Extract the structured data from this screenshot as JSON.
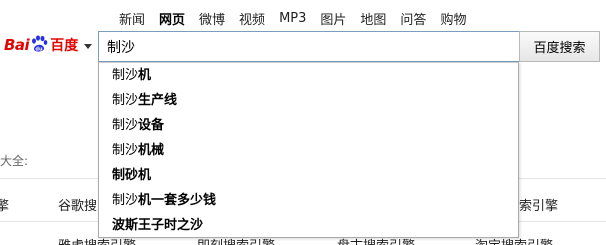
{
  "nav": {
    "items": [
      {
        "label": "新闻",
        "active": false
      },
      {
        "label": "网页",
        "active": true
      },
      {
        "label": "微博",
        "active": false
      },
      {
        "label": "视频",
        "active": false
      },
      {
        "label": "MP3",
        "active": false
      },
      {
        "label": "图片",
        "active": false
      },
      {
        "label": "地图",
        "active": false
      },
      {
        "label": "问答",
        "active": false
      },
      {
        "label": "购物",
        "active": false
      }
    ]
  },
  "logo": {
    "text_bai": "Bai",
    "text_du": "百度",
    "icon": "paw-icon",
    "brand_color": "#e10602"
  },
  "search": {
    "value": "制沙",
    "button_label": "百度搜索"
  },
  "suggestions": [
    {
      "prefix": "制沙",
      "bold": "机"
    },
    {
      "prefix": "制沙",
      "bold": "生产线"
    },
    {
      "prefix": "制沙",
      "bold": "设备"
    },
    {
      "prefix": "制沙",
      "bold": "机械"
    },
    {
      "prefix": "",
      "bold": "制砂机"
    },
    {
      "prefix": "制沙",
      "bold": "机一套多少钱"
    },
    {
      "prefix": "",
      "bold": "波斯王子时之沙"
    }
  ],
  "background": {
    "section_label": "大全:",
    "row1": {
      "col0": "擎",
      "col1": "谷歌搜",
      "col_right": "索引擎"
    },
    "row2": {
      "col1": "雅虎搜索引擎",
      "col2": "即刻搜索引擎",
      "col3": "盘古搜索引擎",
      "col4": "淘宝搜索引擎"
    }
  }
}
